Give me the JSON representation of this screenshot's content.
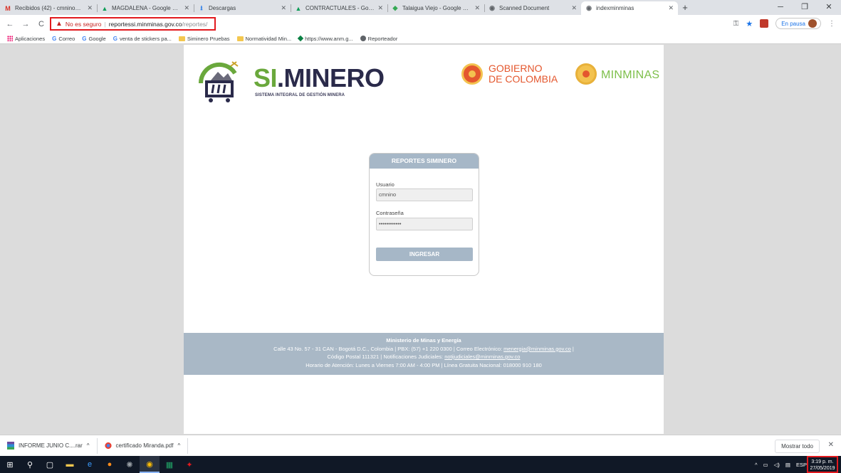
{
  "tabs": [
    {
      "icon": "gmail-icon",
      "title": "Recibidos (42) - cmnino@minen"
    },
    {
      "icon": "drive-icon",
      "title": "MAGDALENA - Google Drive"
    },
    {
      "icon": "download-icon",
      "title": "Descargas"
    },
    {
      "icon": "drive-icon",
      "title": "CONTRACTUALES - Google Drive"
    },
    {
      "icon": "maps-icon",
      "title": "Talaigua Viejo - Google Maps"
    },
    {
      "icon": "globe-icon",
      "title": "Scanned Document"
    },
    {
      "icon": "globe-icon",
      "title": "indexminminas",
      "active": true
    }
  ],
  "toolbar": {
    "insecure_label": "No es seguro",
    "host": "reportessi.minminas.gov.co",
    "path": "/reportes/",
    "pause_label": "En pausa"
  },
  "bookmarks": [
    "Aplicaciones",
    "Correo",
    "Google",
    "venta de stickers pa...",
    "Siminero Pruebas",
    "Normatividad Min...",
    "https://www.anm.g...",
    "Reporteador"
  ],
  "header": {
    "brand_si": "SI",
    "brand_rest": ".MINERO",
    "brand_sub": "SISTEMA INTEGRAL DE GESTIÓN MINERA",
    "gob_line1": "GOBIERNO",
    "gob_line2": "DE COLOMBIA",
    "minminas": "MINMINAS"
  },
  "login": {
    "title": "REPORTES SIMINERO",
    "user_label": "Usuario",
    "user_value": "cmnino",
    "pass_label": "Contraseña",
    "pass_value": "••••••••••••",
    "submit": "INGRESAR"
  },
  "footer": {
    "title": "Ministerio de Minas y Energía",
    "line1_prefix": "Calle 43 No. 57 - 31 CAN - Bogotá D.C., Colombia | PBX: (57) +1 220 0300 | Correo Electrónico: ",
    "email1": "menergia@minminas.gov.co",
    "line1_suffix": " |",
    "line2_prefix": "Código Postal 111321 | Notificaciones Judiciales: ",
    "email2": "notijudiciales@minminas.gov.co",
    "line3": "Horario de Atención: Lunes a Viernes 7:00 AM - 4:00 PM | Línea Gratuita Nacional: 018000 910 180"
  },
  "downloads": [
    {
      "icon": "winrar-icon",
      "name": "INFORME JUNIO C....rar"
    },
    {
      "icon": "pdf-icon",
      "name": "certificado Miranda.pdf"
    }
  ],
  "shelf": {
    "show_all": "Mostrar todo"
  },
  "tray": {
    "lang": "ESP",
    "time": "3:19 p. m.",
    "date": "27/05/2019"
  },
  "colors": {
    "accent_red": "#e2191e",
    "panel": "#a6b7c7",
    "brand_green": "#6aa83c"
  }
}
